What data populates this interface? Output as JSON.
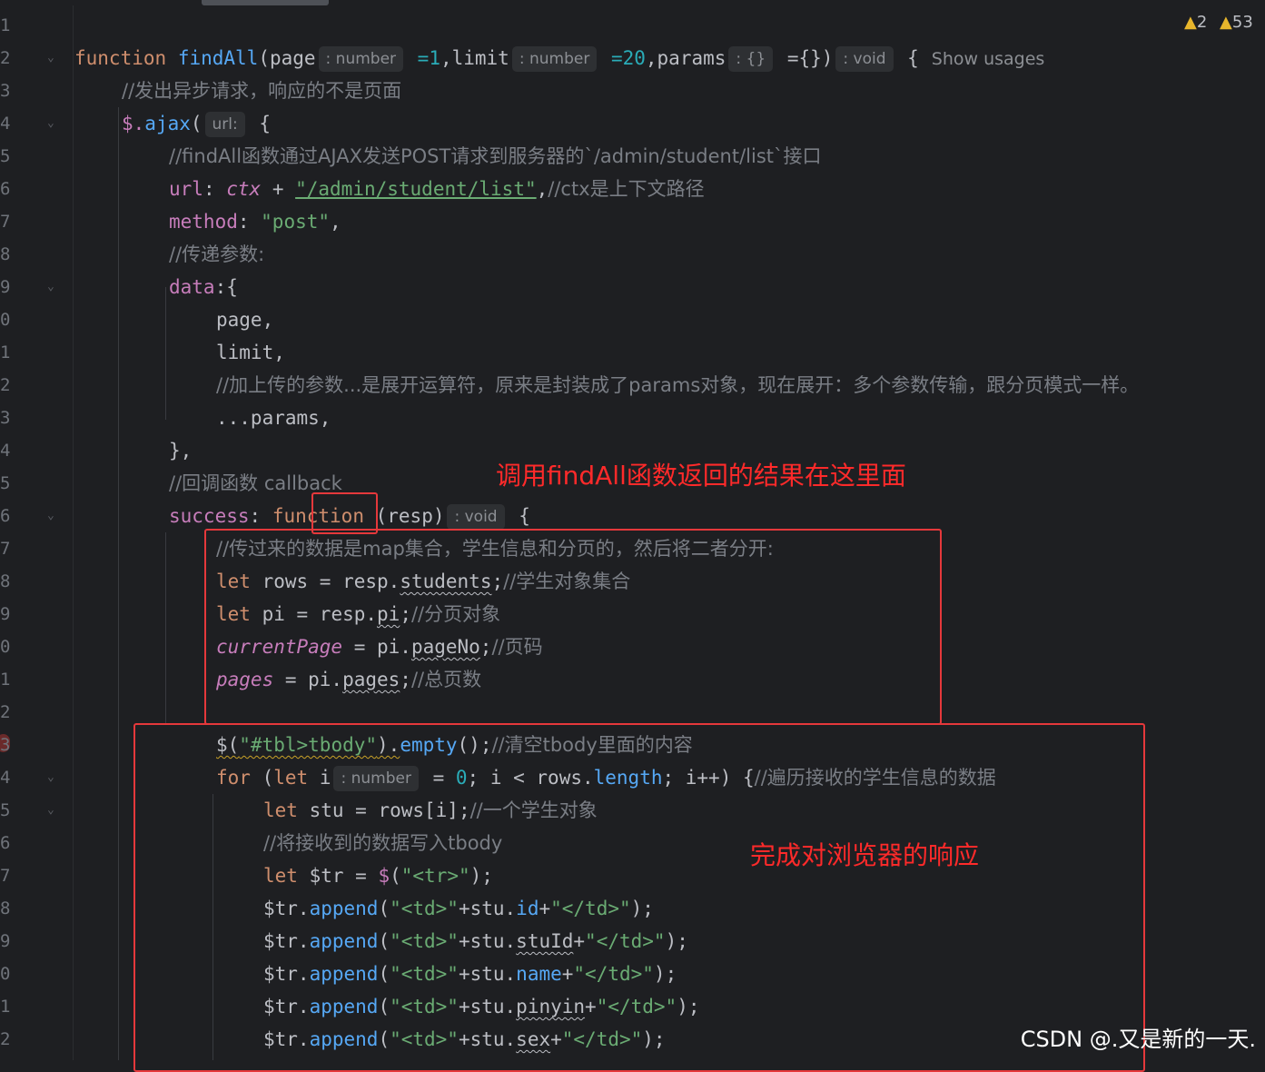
{
  "gutter": {
    "line_numbers": [
      "1",
      "2",
      "3",
      "4",
      "5",
      "6",
      "7",
      "8",
      "9",
      "0",
      "1",
      "2",
      "3",
      "4",
      "5",
      "6",
      "7",
      "8",
      "9",
      "0",
      "1",
      "2",
      "3",
      "4",
      "5",
      "6",
      "7",
      "8",
      "9",
      "0",
      "1",
      "2"
    ]
  },
  "status": {
    "warning_count_1": "2",
    "warning_count_2": "53",
    "warning_icon": "warning-triangle-icon",
    "warning_color": "#e8b62c"
  },
  "inline_hints": {
    "number": ": number",
    "empty_obj": ": {}",
    "void": ": void",
    "url": "url:",
    "show_usages": "Show usages"
  },
  "code": {
    "l2": {
      "kw": "function",
      "name": "findAll",
      "p_open": "(page",
      "p_page_def": " =1",
      "p_limit": ",limit",
      "p_limit_def": " =20",
      "p_params": ",params",
      "p_params_def": " ={})",
      "brace": " {"
    },
    "l3": "//发出异步请求，响应的不是页面",
    "l4": {
      "prefix": "$.",
      "fn": "ajax",
      "paren": "(",
      "brace": " {"
    },
    "l5": "//findAll函数通过AJAX发送POST请求到服务器的`/admin/student/list`接口",
    "l6": {
      "key": "url",
      "colon": ": ",
      "ctx": "ctx",
      "plus": " + ",
      "str": "\"/admin/student/list\"",
      "rest": ",",
      "comment": "//ctx是上下文路径"
    },
    "l7": {
      "key": "method",
      "colon": ": ",
      "str": "\"post\"",
      "rest": ","
    },
    "l8": "//传递参数:",
    "l9": {
      "key": "data",
      "rest": ":{"
    },
    "l10": "page,",
    "l11": "limit,",
    "l12": "//加上传的参数...是展开运算符，原来是封装成了params对象，现在展开：多个参数传输，跟分页模式一样。",
    "l13": "...params,",
    "l14": "},",
    "l15": "//回调函数 callback",
    "l16": {
      "key": "success",
      "colon": ": ",
      "kw": "function",
      "sp": " ",
      "param": "(resp)",
      "brace": " {"
    },
    "l17": "//传过来的数据是map集合，学生信息和分页的，然后将二者分开:",
    "l18": {
      "kw": "let",
      "mid": " rows = resp.",
      "prop": "students",
      "semi": ";",
      "comment": "//学生对象集合"
    },
    "l19": {
      "kw": "let",
      "mid": " pi = resp.",
      "prop": "pi",
      "semi": ";",
      "comment": "//分页对象"
    },
    "l20": {
      "var": "currentPage",
      "mid": " = pi.",
      "prop": "pageNo",
      "semi": ";",
      "comment": "//页码"
    },
    "l21": {
      "var": "pages",
      "mid": " = pi.",
      "prop": "pages",
      "semi": ";",
      "comment": "//总页数"
    },
    "l23": {
      "pre": "$(",
      "str": "\"#tbl>tbody\"",
      "close": ").",
      "fn": "empty",
      "rest": "();",
      "comment": "//清空tbody里面的内容"
    },
    "l24": {
      "kw": "for",
      "p1": " (",
      "kw2": "let",
      "var": " i",
      "eq": " = ",
      "zero": "0",
      "rest": "; i < rows.",
      "prop": "length",
      "rest2": "; i++) {",
      "comment": "//遍历接收的学生信息的数据"
    },
    "l25": {
      "kw": "let",
      "mid": " stu = rows[i];",
      "comment": "//一个学生对象"
    },
    "l26": "//将接收到的数据写入tbody",
    "l27": {
      "kw": "let",
      "mid": " $tr = ",
      "fn": "$",
      "p": "(",
      "str": "\"<tr>\"",
      "rest": ");"
    },
    "appends": [
      {
        "prop": "id"
      },
      {
        "prop": "stuId"
      },
      {
        "prop": "name"
      },
      {
        "prop": "pinyin"
      },
      {
        "prop": "sex"
      }
    ],
    "append_parts": {
      "obj": "$tr.",
      "fn": "append",
      "open": "(",
      "td_open": "\"<td>\"",
      "plus1": "+stu.",
      "plus2": "+",
      "td_close": "\"</td>\"",
      "end": ");"
    }
  },
  "annotations": {
    "callback_note": "调用findAll函数返回的结果在这里面",
    "response_note": "完成对浏览器的响应",
    "color": "#ff2a2a"
  },
  "watermark": "CSDN @.又是新的一天."
}
